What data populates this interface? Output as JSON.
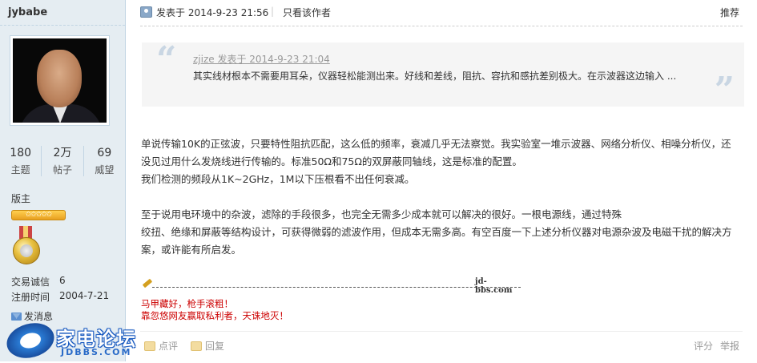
{
  "user": {
    "name": "jybabe",
    "stats": [
      {
        "value": "180",
        "label": "主题"
      },
      {
        "value": "2万",
        "label": "帖子"
      },
      {
        "value": "69",
        "label": "威望"
      }
    ],
    "role": "版主",
    "stars_text": "✩✩✩✩✩",
    "trade_label": "交易诚信",
    "trade_value": "6",
    "reg_label": "注册时间",
    "reg_value": "2004-7-21",
    "message_label": "发消息"
  },
  "watermark": {
    "title": "家电论坛",
    "subtitle": "JDBBS.COM"
  },
  "post": {
    "posted_at": "发表于 2014-9-23 21:56",
    "separator": "|",
    "author_only": "只看该作者",
    "recommend": "推荐",
    "quote": {
      "author": "zjize 发表于 2014-9-23 21:04",
      "text": "其实线材根本不需要用耳朵，仪器轻松能测出来。好线和差线，阻抗、容抗和感抗差别极大。在示波器这边输入 ..."
    },
    "paragraph1_line1": "单说传输10K的正弦波，只要特性阻抗匹配，这么低的频率，衰减几乎无法察觉。我实验室一堆示波器、网络分析仪、相噪分析仪，还没见过用什么发烧线进行传输的。标准50Ω和75Ω的双屏蔽同轴线，这是标准的配置。",
    "paragraph1_line2": "我们检测的频段从1K~2GHz，1M以下压根看不出任何衰减。",
    "paragraph2_line1": "至于说用电环境中的杂波，滤除的手段很多，也完全无需多少成本就可以解决的很好。一根电源线，通过特殊",
    "paragraph2_line2": "绞扭、绝缘和屏蔽等结构设计，可获得微弱的滤波作用，但成本无需多高。有空百度一下上述分析仪器对电源杂波及电磁干扰的解决方案，或许能有所启发。"
  },
  "signature": {
    "mark": "jd-bbs.com",
    "line1": "马甲藏好，枪手滚粗！",
    "line2": "靠忽悠网友赢取私利者，天诛地灭！"
  },
  "footer": {
    "like": "点评",
    "reply": "回复",
    "rate": "评分",
    "report": "举报"
  }
}
